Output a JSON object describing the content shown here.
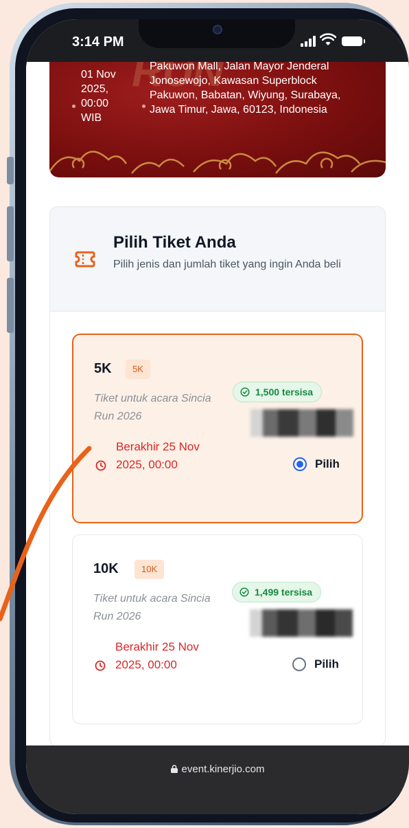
{
  "status_bar": {
    "time": "3:14 PM"
  },
  "event": {
    "date_lines": [
      "01 Nov",
      "2025,",
      "00:00",
      "WIB"
    ],
    "location": "Pakuwon Mall, Jalan Mayor Jenderal Jonosewojo, Kawasan Superblock Pakuwon, Babatan, Wiyung, Surabaya, Jawa Timur, Jawa, 60123, Indonesia"
  },
  "ticket_section": {
    "title": "Pilih Tiket Anda",
    "subtitle": "Pilih jenis dan jumlah tiket yang ingin Anda beli",
    "select_label": "Pilih",
    "tickets": [
      {
        "name": "5K",
        "badge": "5K",
        "description": "Tiket untuk acara Sincia Run 2026",
        "deadline": "Berakhir 25 Nov 2025, 00:00",
        "stock": "1,500 tersisa",
        "selected": true
      },
      {
        "name": "10K",
        "badge": "10K",
        "description": "Tiket untuk acara Sincia Run 2026",
        "deadline": "Berakhir 25 Nov 2025, 00:00",
        "stock": "1,499 tersisa",
        "selected": false
      }
    ]
  },
  "browser": {
    "url": "event.kinerjio.com"
  },
  "colors": {
    "accent_orange": "#e8621a",
    "banner_red": "#7b0f0f",
    "stock_green": "#18883f",
    "deadline_red": "#dc2626",
    "radio_blue": "#2563eb",
    "page_background": "#fbe9df"
  }
}
